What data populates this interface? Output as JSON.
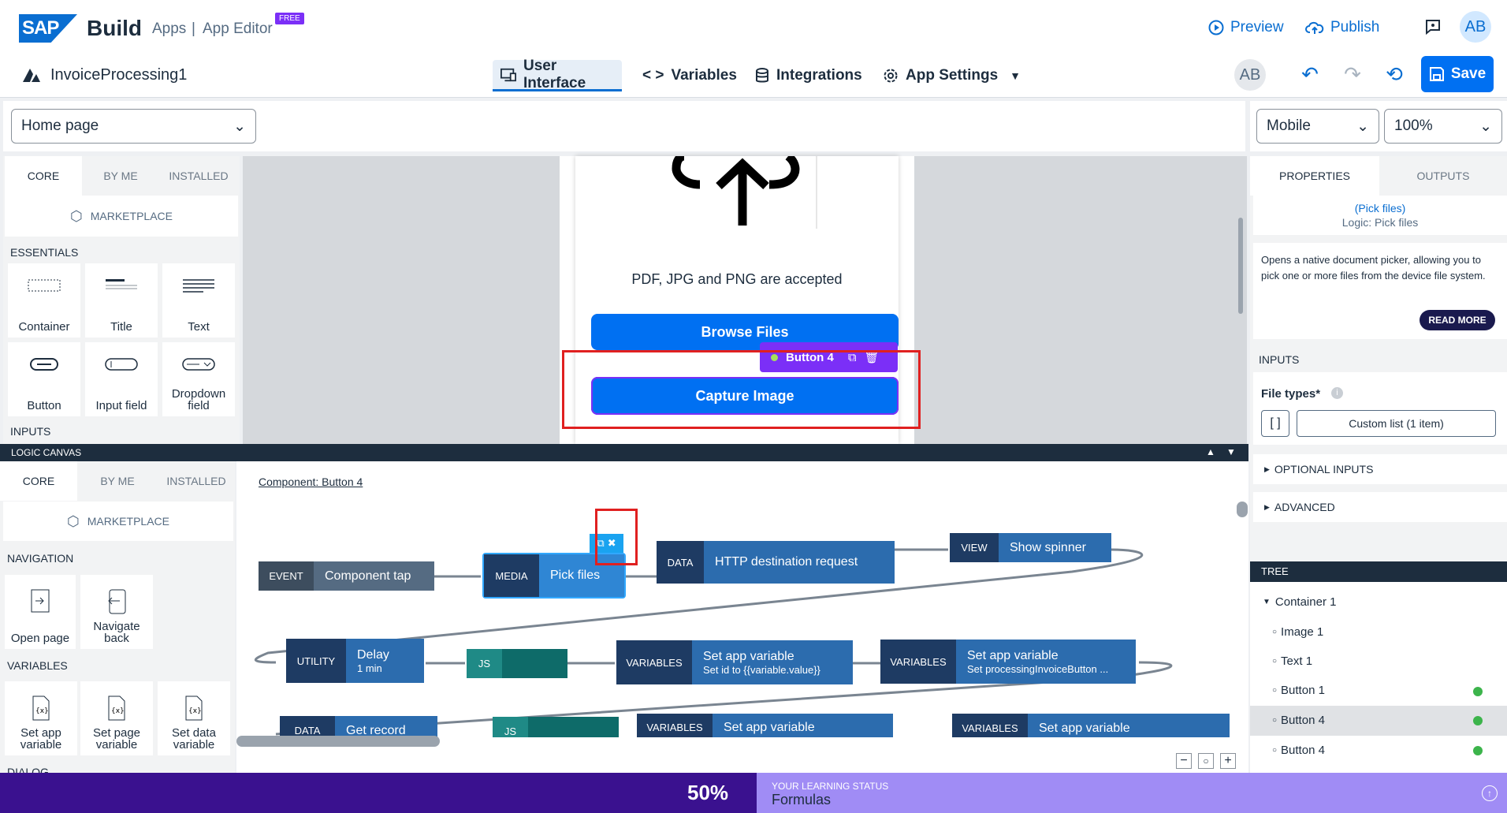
{
  "header": {
    "logo": "SAP",
    "brand": "Build",
    "crumb_apps": "Apps",
    "crumb_sep": "|",
    "crumb_editor": "App Editor",
    "free_badge": "FREE",
    "preview": "Preview",
    "publish": "Publish",
    "user_initials": "AB",
    "app_name": "InvoiceProcessing1",
    "nav": [
      "User Interface",
      "Variables",
      "Integrations",
      "App Settings"
    ],
    "save": "Save"
  },
  "toolbar": {
    "page_select": "Home page",
    "device_select": "Mobile",
    "zoom_select": "100%"
  },
  "palette": {
    "tabs": [
      "CORE",
      "BY ME",
      "INSTALLED"
    ],
    "marketplace": "MARKETPLACE",
    "essentials_heading": "ESSENTIALS",
    "essentials": [
      "Container",
      "Title",
      "Text",
      "Button",
      "Input field",
      "Dropdown field"
    ],
    "inputs_heading": "INPUTS"
  },
  "canvas": {
    "accepted_text": "PDF, JPG and PNG are accepted",
    "browse_button": "Browse Files",
    "capture_button": "Capture Image",
    "selection_label": "Button 4"
  },
  "right_panel": {
    "tabs": [
      "PROPERTIES",
      "OUTPUTS"
    ],
    "link_label": "(Pick files)",
    "logic_label": "Logic: Pick files",
    "description": "Opens a native document picker, allowing you to pick one or more files from the device file system.",
    "read_more": "READ MORE",
    "inputs_heading": "INPUTS",
    "file_types_label": "File types*",
    "file_types_value": "Custom list (1 item)",
    "optional_inputs": "OPTIONAL INPUTS",
    "advanced": "ADVANCED"
  },
  "tree": {
    "heading": "TREE",
    "items": [
      "Container 1",
      "Image 1",
      "Text 1",
      "Button 1",
      "Button 4",
      "Button 4"
    ]
  },
  "logic": {
    "bar_title": "LOGIC CANVAS",
    "tabs": [
      "CORE",
      "BY ME",
      "INSTALLED"
    ],
    "marketplace": "MARKETPLACE",
    "nav_heading": "NAVIGATION",
    "nav_items": [
      "Open page",
      "Navigate back"
    ],
    "var_heading": "VARIABLES",
    "var_items": [
      "Set app variable",
      "Set page variable",
      "Set data variable"
    ],
    "dialog_heading": "DIALOG",
    "component_link": "Component: Button 4",
    "nodes": [
      {
        "kind": "EVENT",
        "label": "Component tap",
        "sub": ""
      },
      {
        "kind": "MEDIA",
        "label": "Pick files",
        "sub": ""
      },
      {
        "kind": "DATA",
        "label": "HTTP destination request",
        "sub": ""
      },
      {
        "kind": "VIEW",
        "label": "Show spinner",
        "sub": ""
      },
      {
        "kind": "UTILITY",
        "label": "Delay",
        "sub": "1 min"
      },
      {
        "kind": "JS",
        "label": "",
        "sub": ""
      },
      {
        "kind": "VARIABLES",
        "label": "Set app variable",
        "sub": "Set id to {{variable.value}}"
      },
      {
        "kind": "VARIABLES",
        "label": "Set app variable",
        "sub": "Set processingInvoiceButton ..."
      },
      {
        "kind": "DATA",
        "label": "Get record",
        "sub": ""
      },
      {
        "kind": "JS",
        "label": "",
        "sub": ""
      },
      {
        "kind": "VARIABLES",
        "label": "Set app variable",
        "sub": ""
      },
      {
        "kind": "VARIABLES",
        "label": "Set app variable",
        "sub": ""
      }
    ]
  },
  "learning": {
    "percent": "50%",
    "status_label": "YOUR LEARNING STATUS",
    "status_value": "Formulas"
  },
  "colors": {
    "accent": "#0070f2",
    "purple": "#7b2ff7",
    "node_dark": "#1e3b63",
    "node_light": "#2c6cae",
    "highlight": "#e02020"
  }
}
